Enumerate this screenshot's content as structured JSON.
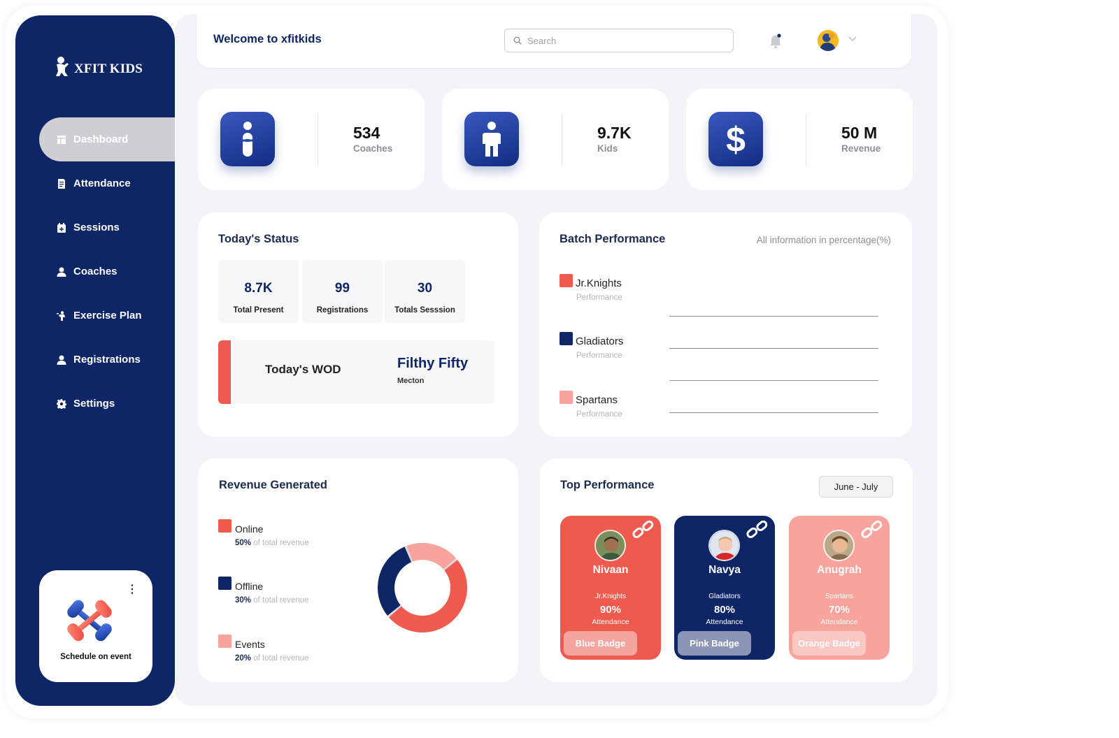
{
  "brand": {
    "name": "XFIT KIDS"
  },
  "sidebar": {
    "items": [
      {
        "label": "Dashboard",
        "icon": "dashboard-icon"
      },
      {
        "label": "Attendance",
        "icon": "clipboard-icon"
      },
      {
        "label": "Sessions",
        "icon": "calendar-plus-icon"
      },
      {
        "label": "Coaches",
        "icon": "user-icon"
      },
      {
        "label": "Exercise Plan",
        "icon": "exercise-icon"
      },
      {
        "label": "Registrations",
        "icon": "user-icon"
      },
      {
        "label": "Settings",
        "icon": "gear-icon"
      }
    ],
    "active": "Dashboard",
    "promo": {
      "label": "Schedule on event"
    }
  },
  "header": {
    "welcome": "Welcome to xfitkids",
    "search_placeholder": "Search"
  },
  "stats": [
    {
      "value": "534",
      "label": "Coaches",
      "icon": "coach-icon"
    },
    {
      "value": "9.7K",
      "label": "Kids",
      "icon": "kid-icon"
    },
    {
      "value": "50 M",
      "label": "Revenue",
      "icon": "dollar-icon"
    }
  ],
  "today_status": {
    "title": "Today's Status",
    "metrics": [
      {
        "value": "8.7K",
        "label": "Total Present"
      },
      {
        "value": "99",
        "label": "Registrations"
      },
      {
        "value": "30",
        "label": "Totals Sesssion"
      }
    ],
    "wod": {
      "label": "Today's WOD",
      "name": "Filthy Fifty",
      "sub": "Mecton"
    }
  },
  "batch_performance": {
    "title": "Batch Performance",
    "note": "All information in percentage(%)",
    "batches": [
      {
        "name": "Jr.Knights",
        "sub": "Performance",
        "color": "#ef5a4f"
      },
      {
        "name": "Gladiators",
        "sub": "Performance",
        "color": "#0e2566"
      },
      {
        "name": "Spartans",
        "sub": "Performance",
        "color": "#f8a39b"
      }
    ]
  },
  "revenue": {
    "title": "Revenue Generated",
    "suffix": "of total revenue",
    "items": [
      {
        "name": "Online",
        "pct": "50%",
        "color": "#ef5a4f"
      },
      {
        "name": "Offline",
        "pct": "30%",
        "color": "#0e2566"
      },
      {
        "name": "Events",
        "pct": "20%",
        "color": "#f8a39b"
      }
    ]
  },
  "chart_data": {
    "type": "pie",
    "labels": [
      "Online",
      "Offline",
      "Events"
    ],
    "values": [
      50,
      30,
      20
    ],
    "colors": [
      "#ef5a4f",
      "#0e2566",
      "#f8a39b"
    ],
    "donut": true
  },
  "top_performance": {
    "title": "Top Performance",
    "range": "June - July",
    "cards": [
      {
        "name": "Nivaan",
        "team": "Jr.Knights",
        "pct": "90%",
        "att": "Attendance",
        "badge": "Blue Badge",
        "bg": "#ef5a4f",
        "badge_bg": "#f6a49e",
        "badge_fg": "#ffffff"
      },
      {
        "name": "Navya",
        "team": "Gladiators",
        "pct": "80%",
        "att": "Attendance",
        "badge": "Pink Badge",
        "bg": "#0e2566",
        "badge_bg": "#8b95b5",
        "badge_fg": "#ffffff"
      },
      {
        "name": "Anugrah",
        "team": "Spartans",
        "pct": "70%",
        "att": "Attendance",
        "badge": "Orange Badge",
        "bg": "#f8a39b",
        "badge_bg": "#fbc7c2",
        "badge_fg": "#ffffff"
      }
    ]
  }
}
